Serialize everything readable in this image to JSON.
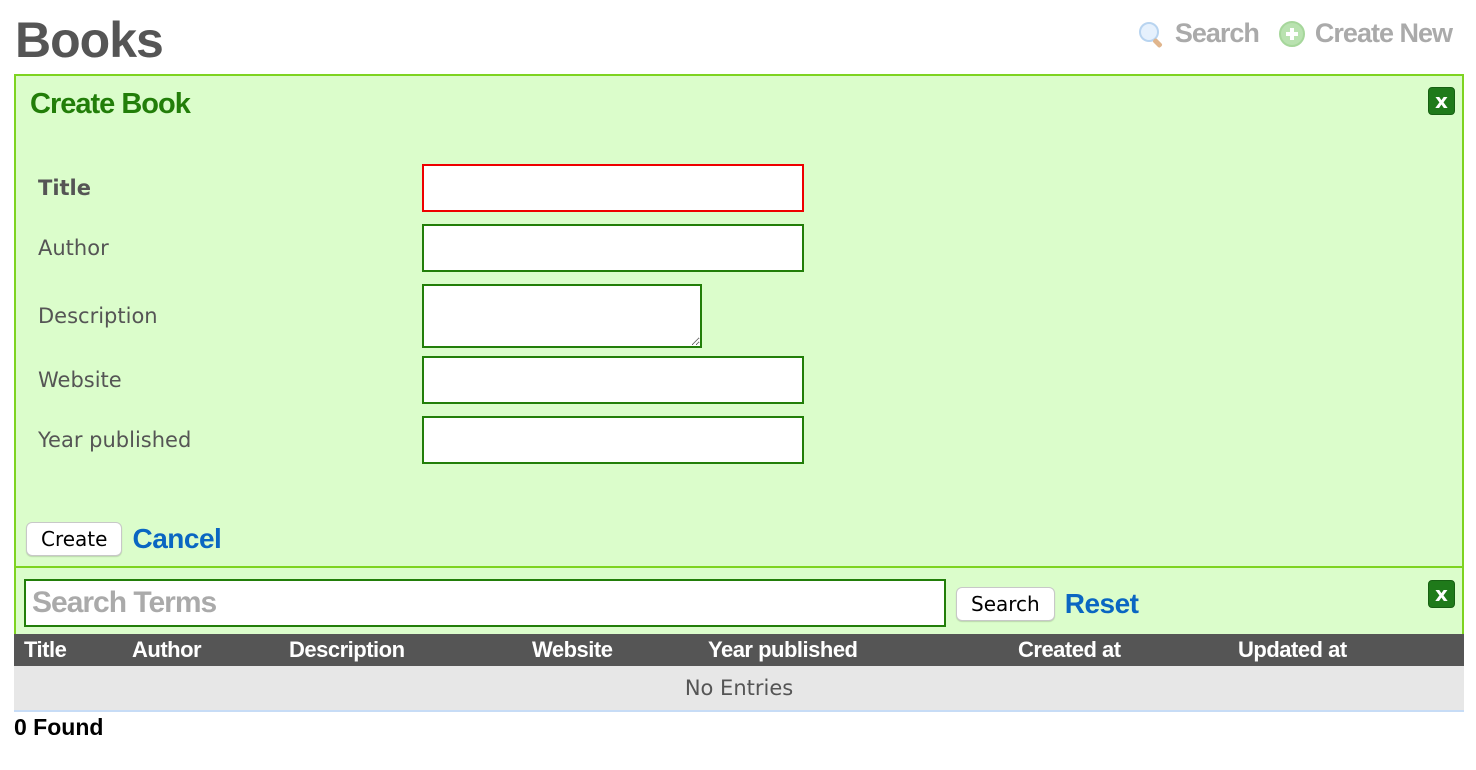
{
  "page": {
    "title": "Books"
  },
  "top_actions": {
    "search": {
      "label": "Search",
      "icon": "magnifier-icon"
    },
    "create_new": {
      "label": "Create New",
      "icon": "plus-circle-icon"
    }
  },
  "create_form": {
    "title": "Create Book",
    "close_label": "x",
    "fields": [
      {
        "label": "Title",
        "value": "",
        "required": true,
        "type": "text",
        "state": "error"
      },
      {
        "label": "Author",
        "value": "",
        "required": false,
        "type": "text"
      },
      {
        "label": "Description",
        "value": "",
        "required": false,
        "type": "textarea"
      },
      {
        "label": "Website",
        "value": "",
        "required": false,
        "type": "text"
      },
      {
        "label": "Year published",
        "value": "",
        "required": false,
        "type": "text"
      }
    ],
    "submit_label": "Create",
    "cancel_label": "Cancel"
  },
  "search": {
    "placeholder": "Search Terms",
    "value": "",
    "button_label": "Search",
    "reset_label": "Reset",
    "close_label": "x"
  },
  "table": {
    "columns": [
      "Title",
      "Author",
      "Description",
      "Website",
      "Year published",
      "Created at",
      "Updated at"
    ],
    "rows": [],
    "empty_message": "No Entries"
  },
  "results": {
    "count_text": "0 Found"
  },
  "colors": {
    "panel_bg": "#dbfdcb",
    "panel_border": "#7ed321",
    "heading_green": "#227e09",
    "error_red": "#ee0000",
    "link_blue": "#0a66c2",
    "table_header_bg": "#555555"
  }
}
